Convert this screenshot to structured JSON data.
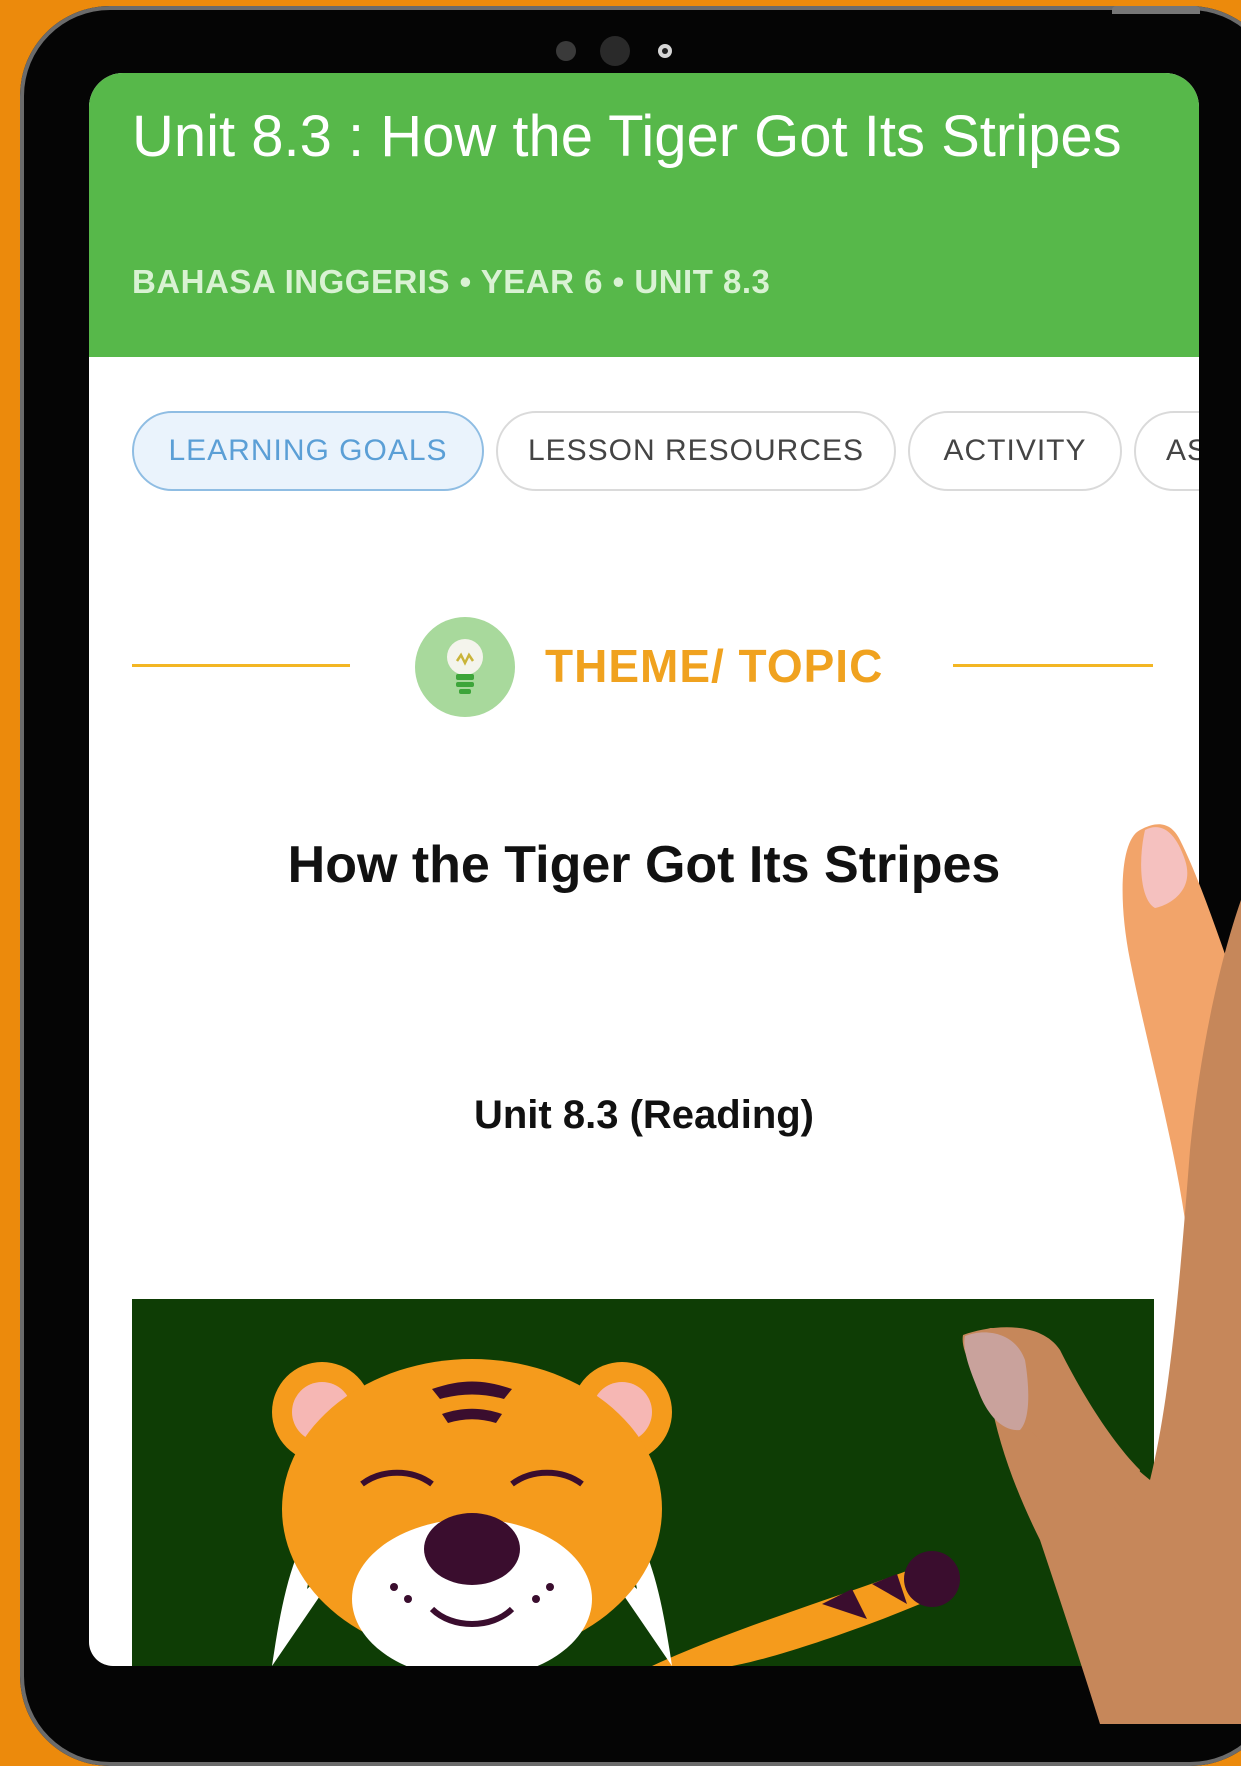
{
  "header": {
    "title": "Unit 8.3 : How the Tiger Got Its Stripes",
    "subtitle": "BAHASA INGGERIS • YEAR 6 • UNIT 8.3"
  },
  "tabs": [
    {
      "label": "LEARNING GOALS",
      "active": true
    },
    {
      "label": "LESSON RESOURCES",
      "active": false
    },
    {
      "label": "ACTIVITY",
      "active": false
    },
    {
      "label": "AS",
      "active": false
    }
  ],
  "section": {
    "icon": "lightbulb-icon",
    "label": "THEME/ TOPIC"
  },
  "content": {
    "title": "How the Tiger Got Its Stripes",
    "subtitle": "Unit 8.3 (Reading)"
  },
  "colors": {
    "background": "#ec8a0c",
    "header": "#57b84a",
    "accent": "#f0a21f",
    "active_tab": "#5b9fd6",
    "illustration_bg": "#0e3d05"
  }
}
